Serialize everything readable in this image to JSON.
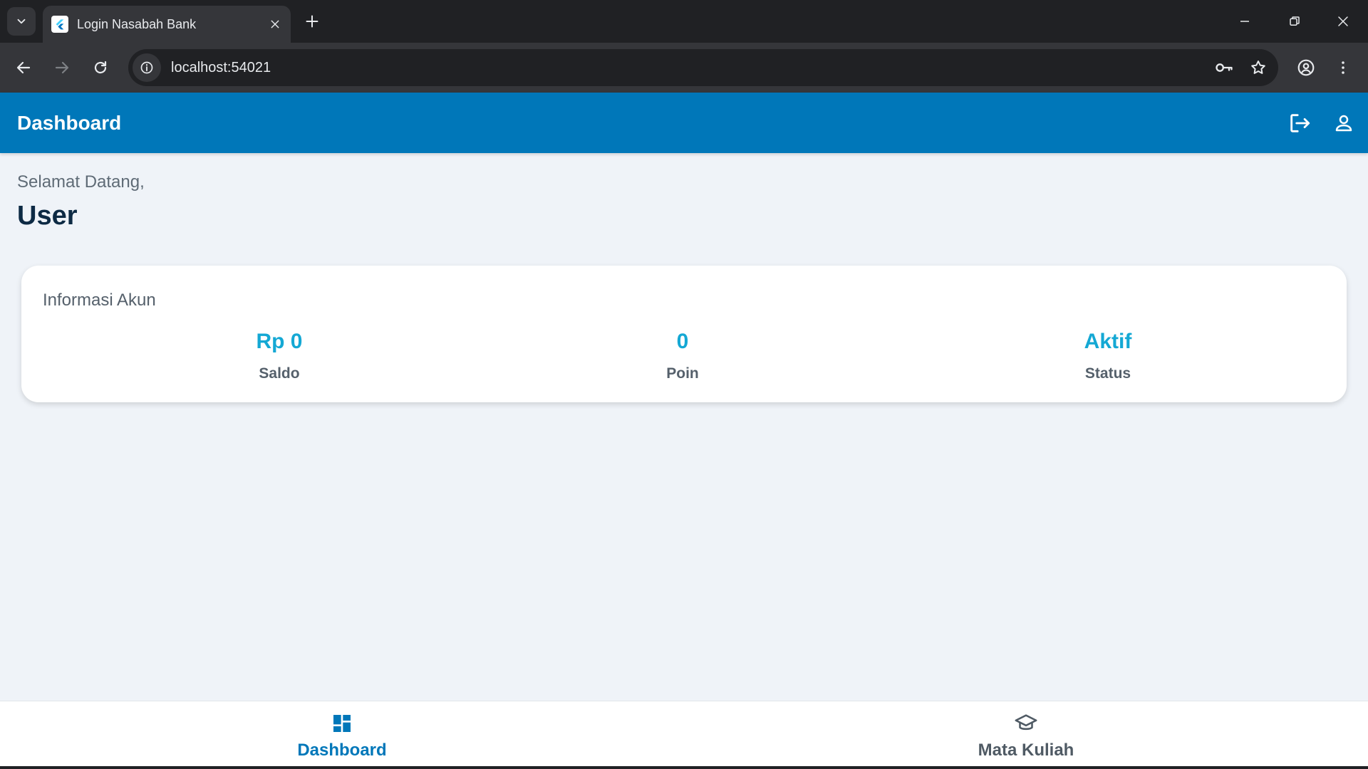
{
  "browser": {
    "tab_title": "Login Nasabah Bank",
    "url": "localhost:54021",
    "icons": {
      "tab_search": "chevron-down-icon",
      "favicon": "flutter-logo-icon",
      "tab_close": "close-icon",
      "new_tab": "plus-icon",
      "minimize": "minimize-icon",
      "restore": "restore-icon",
      "close_window": "close-icon",
      "back": "arrow-left-icon",
      "forward": "arrow-right-icon",
      "reload": "reload-icon",
      "site_info": "info-icon",
      "password": "key-icon",
      "bookmark": "star-icon",
      "profile": "account-circle-icon",
      "menu": "more-vert-icon"
    }
  },
  "appbar": {
    "title": "Dashboard",
    "icons": [
      "logout-icon",
      "person-icon"
    ]
  },
  "welcome": {
    "greeting": "Selamat Datang,",
    "name": "User"
  },
  "account_card": {
    "title": "Informasi Akun",
    "stats": [
      {
        "value": "Rp 0",
        "label": "Saldo"
      },
      {
        "value": "0",
        "label": "Poin"
      },
      {
        "value": "Aktif",
        "label": "Status"
      }
    ]
  },
  "bottom_nav": {
    "items": [
      {
        "label": "Dashboard",
        "icon": "dashboard-icon",
        "active": true
      },
      {
        "label": "Mata Kuliah",
        "icon": "school-icon",
        "active": false
      }
    ]
  },
  "colors": {
    "primary": "#0077b9",
    "accent_value": "#14a8d4",
    "background": "#eff3f8",
    "heading": "#0d2a44"
  }
}
